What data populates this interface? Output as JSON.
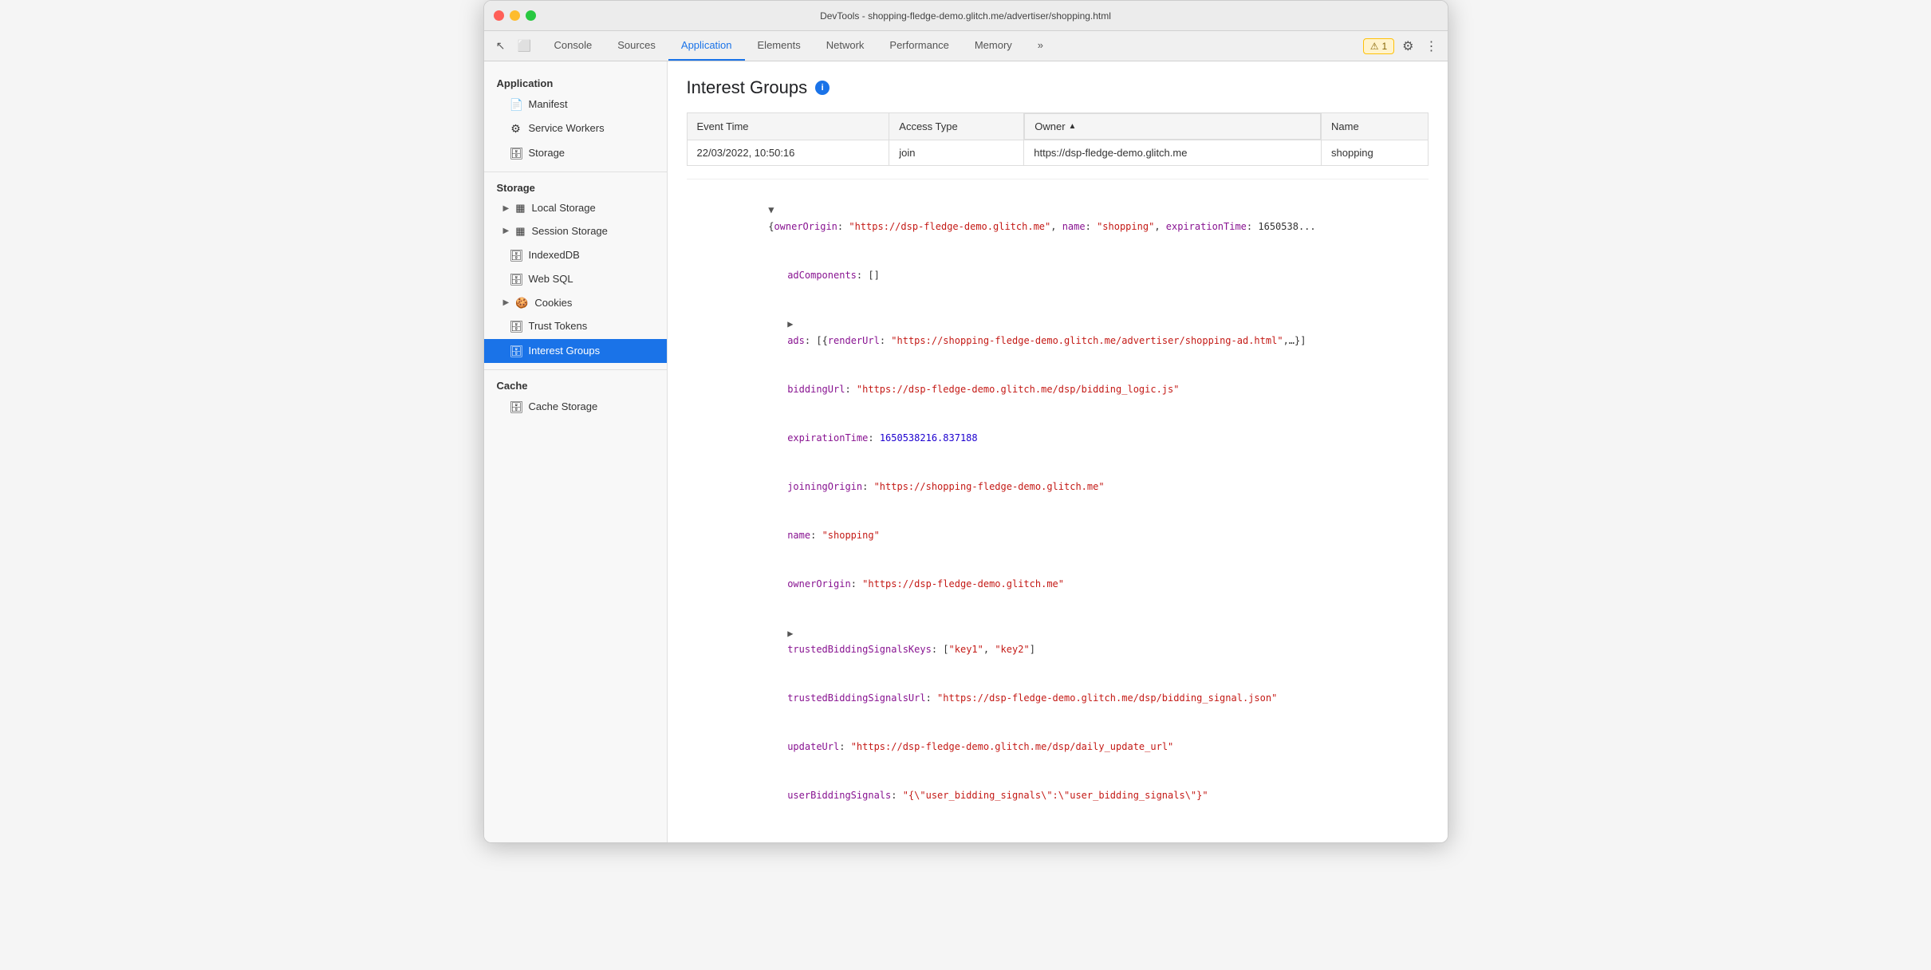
{
  "titlebar": {
    "title": "DevTools - shopping-fledge-demo.glitch.me/advertiser/shopping.html"
  },
  "toolbar": {
    "tabs": [
      {
        "id": "console",
        "label": "Console",
        "active": false
      },
      {
        "id": "sources",
        "label": "Sources",
        "active": false
      },
      {
        "id": "application",
        "label": "Application",
        "active": true
      },
      {
        "id": "elements",
        "label": "Elements",
        "active": false
      },
      {
        "id": "network",
        "label": "Network",
        "active": false
      },
      {
        "id": "performance",
        "label": "Performance",
        "active": false
      },
      {
        "id": "memory",
        "label": "Memory",
        "active": false
      }
    ],
    "warning_count": "1",
    "more_tabs_label": "»"
  },
  "sidebar": {
    "application_section": "Application",
    "application_items": [
      {
        "id": "manifest",
        "label": "Manifest",
        "icon": "📄"
      },
      {
        "id": "service-workers",
        "label": "Service Workers",
        "icon": "⚙️"
      },
      {
        "id": "storage",
        "label": "Storage",
        "icon": "🗄️"
      }
    ],
    "storage_section": "Storage",
    "storage_items": [
      {
        "id": "local-storage",
        "label": "Local Storage",
        "icon": "▦",
        "expandable": true
      },
      {
        "id": "session-storage",
        "label": "Session Storage",
        "icon": "▦",
        "expandable": true
      },
      {
        "id": "indexeddb",
        "label": "IndexedDB",
        "icon": "🗄️",
        "expandable": false
      },
      {
        "id": "web-sql",
        "label": "Web SQL",
        "icon": "🗄️",
        "expandable": false
      },
      {
        "id": "cookies",
        "label": "Cookies",
        "icon": "🍪",
        "expandable": true
      },
      {
        "id": "trust-tokens",
        "label": "Trust Tokens",
        "icon": "🗄️",
        "expandable": false
      },
      {
        "id": "interest-groups",
        "label": "Interest Groups",
        "icon": "🗄️",
        "expandable": false,
        "active": true
      }
    ],
    "cache_section": "Cache",
    "cache_items": [
      {
        "id": "cache-storage",
        "label": "Cache Storage",
        "icon": "🗄️",
        "expandable": false
      }
    ]
  },
  "content": {
    "title": "Interest Groups",
    "table": {
      "columns": [
        "Event Time",
        "Access Type",
        "Owner",
        "Name"
      ],
      "sorted_col": "Owner",
      "rows": [
        {
          "event_time": "22/03/2022, 10:50:16",
          "access_type": "join",
          "owner": "https://dsp-fledge-demo.glitch.me",
          "name": "shopping"
        }
      ]
    },
    "json": {
      "root_open": "▼ {ownerOrigin: \"https://dsp-fledge-demo.glitch.me\", name: \"shopping\", expirationTime: 1650538...",
      "lines": [
        {
          "indent": 1,
          "type": "plain",
          "content": "adComponents: []"
        },
        {
          "indent": 1,
          "type": "expandable",
          "content": "▶ ads: [{renderUrl: \"https://shopping-fledge-demo.glitch.me/advertiser/shopping-ad.html\",...}]"
        },
        {
          "indent": 1,
          "type": "key-string",
          "key": "biddingUrl",
          "value": "\"https://dsp-fledge-demo.glitch.me/dsp/bidding_logic.js\""
        },
        {
          "indent": 1,
          "type": "key-number",
          "key": "expirationTime",
          "value": "1650538216.837188"
        },
        {
          "indent": 1,
          "type": "key-string",
          "key": "joiningOrigin",
          "value": "\"https://shopping-fledge-demo.glitch.me\""
        },
        {
          "indent": 1,
          "type": "key-string",
          "key": "name",
          "value": "\"shopping\""
        },
        {
          "indent": 1,
          "type": "key-string",
          "key": "ownerOrigin",
          "value": "\"https://dsp-fledge-demo.glitch.me\""
        },
        {
          "indent": 1,
          "type": "expandable",
          "content": "▶ trustedBiddingSignalsKeys: [\"key1\", \"key2\"]"
        },
        {
          "indent": 1,
          "type": "key-string",
          "key": "trustedBiddingSignalsUrl",
          "value": "\"https://dsp-fledge-demo.glitch.me/dsp/bidding_signal.json\""
        },
        {
          "indent": 1,
          "type": "key-string",
          "key": "updateUrl",
          "value": "\"https://dsp-fledge-demo.glitch.me/dsp/daily_update_url\""
        },
        {
          "indent": 1,
          "type": "key-string",
          "key": "userBiddingSignals",
          "value": "\"{\\\"user_bidding_signals\\\":\\\"user_bidding_signals\\\"}\""
        }
      ]
    }
  },
  "icons": {
    "cursor": "↖",
    "device": "⬜",
    "gear": "⚙",
    "warning": "⚠",
    "more": "⋮",
    "chevron_right": "▶",
    "chevron_down": "▼"
  }
}
